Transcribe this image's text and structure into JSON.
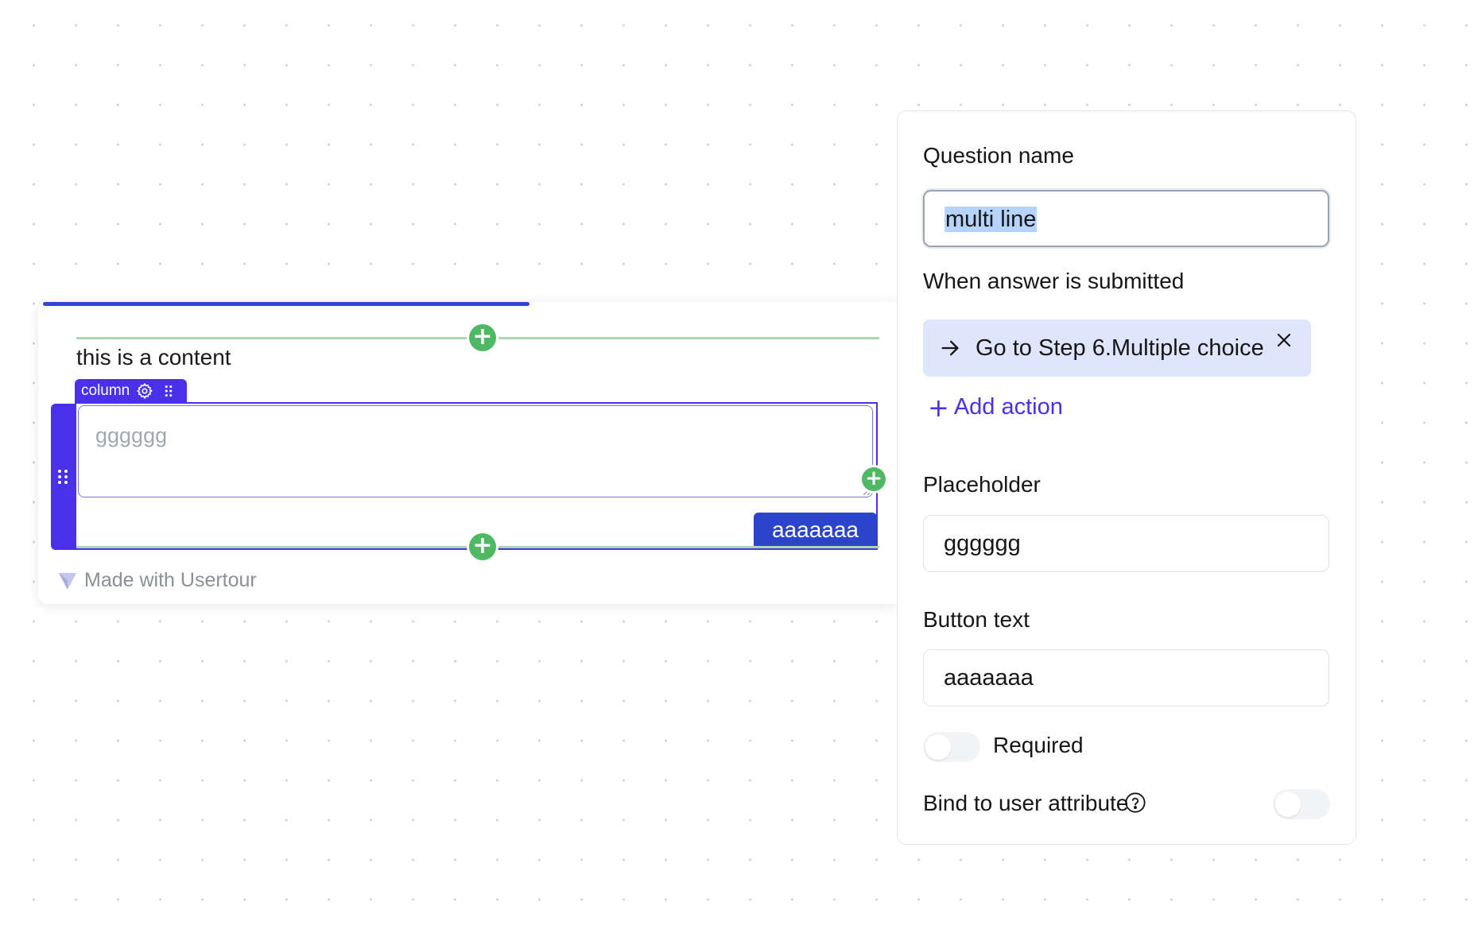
{
  "editor": {
    "content_text": "this is a content",
    "column_tag_label": "column",
    "textarea_placeholder": "gggggg",
    "submit_button_label": "aaaaaaa",
    "branding_text": "Made with Usertour",
    "progress": 0.57
  },
  "panel": {
    "question_name_label": "Question name",
    "question_name_value": "multi line",
    "on_submit_label": "When answer is submitted",
    "action_chip_label": "Go to Step 6.Multiple choice",
    "add_action_label": "Add action",
    "placeholder_label": "Placeholder",
    "placeholder_value": "gggggg",
    "button_text_label": "Button text",
    "button_text_value": "aaaaaaa",
    "required_label": "Required",
    "required_on": false,
    "bind_attribute_label": "Bind to user attribute",
    "bind_attribute_on": false
  },
  "colors": {
    "accent_purple": "#4a30e8",
    "button_blue": "#2c44c9",
    "add_green": "#4fb865",
    "chip_bg": "#dfe5fb",
    "selection": "#b6d4fb"
  },
  "icons": {
    "plus": "plus-icon",
    "gear": "gear-icon",
    "drag": "drag-handle-icon",
    "arrow": "arrow-right-icon",
    "close": "close-icon",
    "help": "help-circle-icon",
    "logo": "usertour-logo-icon"
  }
}
